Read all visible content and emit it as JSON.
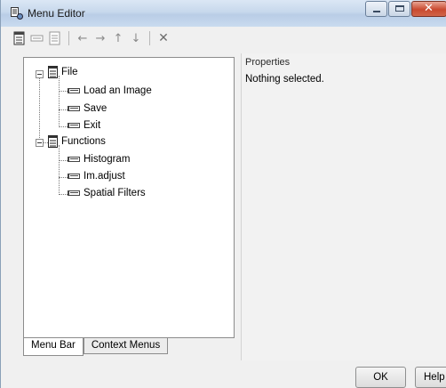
{
  "window": {
    "title": "Menu Editor",
    "icon": "menu-editor-icon",
    "caption_buttons": [
      "minimize",
      "maximize",
      "close"
    ]
  },
  "toolbar": {
    "buttons": [
      "new-menu-icon",
      "new-menu-item-icon",
      "new-context-menu-icon",
      "move-left-icon",
      "move-right-icon",
      "move-up-icon",
      "move-down-icon",
      "delete-icon"
    ]
  },
  "tree": {
    "menus": [
      {
        "label": "File",
        "expanded": true,
        "items": [
          "Load an Image",
          "Save",
          "Exit"
        ]
      },
      {
        "label": "Functions",
        "expanded": true,
        "items": [
          "Histogram",
          "Im.adjust",
          "Spatial Filters"
        ]
      }
    ]
  },
  "tabs": {
    "menu_bar": "Menu Bar",
    "context_menus": "Context Menus",
    "active": "Menu Bar"
  },
  "properties": {
    "title": "Properties",
    "message": "Nothing selected."
  },
  "buttons": {
    "ok": "OK",
    "help": "Help"
  },
  "colors": {
    "titlebar": "#c7d8ec",
    "close_button": "#c9492f",
    "panel_bg": "#ffffff",
    "window_bg": "#f0f0f0"
  }
}
